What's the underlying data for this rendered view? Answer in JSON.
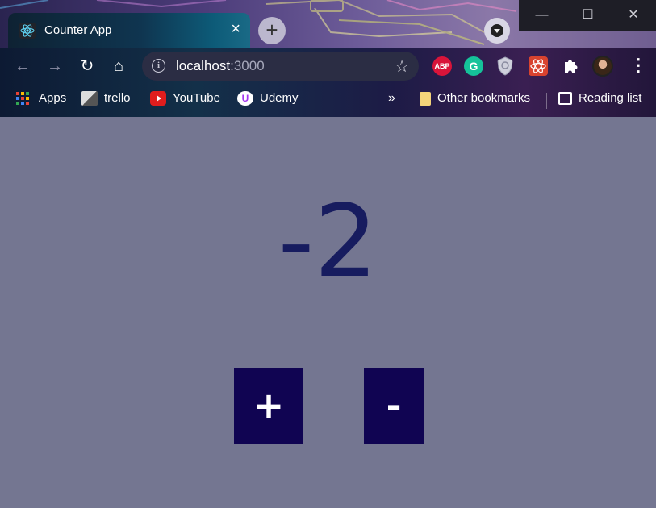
{
  "browser": {
    "tab": {
      "title": "Counter App",
      "close_glyph": "×",
      "icon": "react-icon"
    },
    "new_tab_glyph": "+",
    "window_controls": [
      "—",
      "☐",
      "✕"
    ],
    "nav": {
      "back": "←",
      "forward": "→",
      "reload": "↻",
      "home": "⌂"
    },
    "address": {
      "host": "localhost",
      "port": ":3000"
    },
    "bookmark_star": "☆",
    "extensions": {
      "abp": "ABP",
      "grammarly": "G"
    },
    "menu_glyph": "⋮",
    "bookmarks": [
      {
        "label": "Apps",
        "icon": "apps-grid-icon"
      },
      {
        "label": "trello",
        "icon": "trello-icon"
      },
      {
        "label": "YouTube",
        "icon": "youtube-icon"
      },
      {
        "label": "Udemy",
        "icon": "udemy-icon"
      }
    ],
    "bookmarks_overflow": "»",
    "other_bookmarks": "Other bookmarks",
    "reading_list": "Reading list"
  },
  "app": {
    "count": "-2",
    "increment_label": "+",
    "decrement_label": "-"
  },
  "colors": {
    "page_bg": "#747691",
    "counter_text": "#171c5f",
    "button_bg": "#100452",
    "button_text": "#ffffff"
  }
}
